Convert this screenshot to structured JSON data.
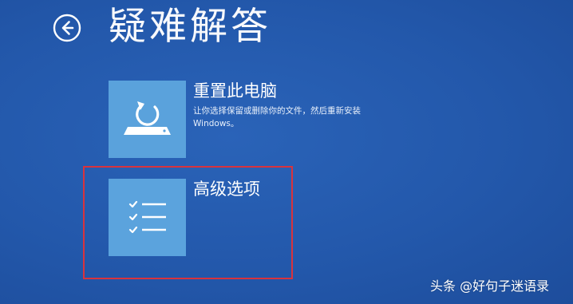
{
  "page": {
    "title": "疑难解答"
  },
  "options": [
    {
      "icon": "reset-pc-icon",
      "title": "重置此电脑",
      "description": "让你选择保留或删除你的文件，然后重新安装 Windows。"
    },
    {
      "icon": "checklist-icon",
      "title": "高级选项"
    }
  ],
  "watermark": {
    "text": "头条 @好句子迷语录"
  },
  "colors": {
    "background": "#2358ab",
    "tile": "#5aa2dc",
    "highlight": "#d8333d",
    "text": "#ffffff"
  }
}
